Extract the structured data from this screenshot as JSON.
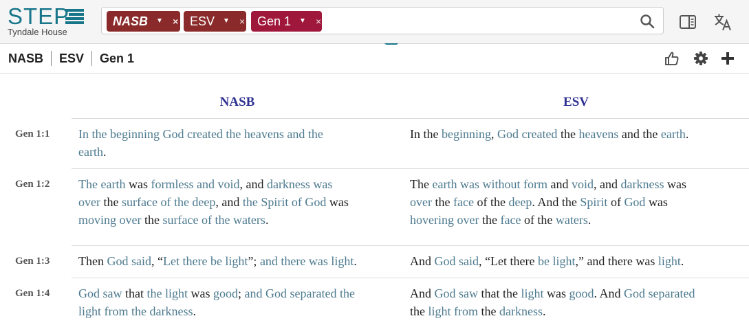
{
  "header": {
    "logo_text": "STEP",
    "logo_subtitle": "Tyndale House",
    "search_tags": [
      {
        "label": "NASB"
      },
      {
        "label": "ESV"
      },
      {
        "label": "Gen 1"
      }
    ],
    "remove_symbol": "×",
    "caret_symbol": "▼"
  },
  "subbar": {
    "crumbs": [
      "NASB",
      "ESV",
      "Gen 1"
    ]
  },
  "columns": {
    "left": "NASB",
    "right": "ESV"
  },
  "colors": {
    "brand": "#18768a",
    "tag_version": "#8b2a2a",
    "tag_reference": "#a0173c",
    "column_heading": "#2e3192",
    "linked_word": "#4d7a8f"
  },
  "verses": [
    {
      "ref": "Gen 1:1",
      "nasb": [
        [
          {
            "t": "In the beginning God created the heavens and the",
            "l": true
          }
        ],
        [
          {
            "t": "earth",
            "l": true
          },
          {
            "t": ".",
            "l": false
          }
        ]
      ],
      "esv": [
        [
          {
            "t": "In the ",
            "l": false
          },
          {
            "t": "beginning",
            "l": true
          },
          {
            "t": ", ",
            "l": false
          },
          {
            "t": "God created",
            "l": true
          },
          {
            "t": " the ",
            "l": false
          },
          {
            "t": "heavens",
            "l": true
          },
          {
            "t": " and the ",
            "l": false
          },
          {
            "t": "earth",
            "l": true
          },
          {
            "t": ".",
            "l": false
          }
        ]
      ]
    },
    {
      "ref": "Gen 1:2",
      "nasb": [
        [
          {
            "t": "The earth",
            "l": true
          },
          {
            "t": " was ",
            "l": false
          },
          {
            "t": "formless and void",
            "l": true
          },
          {
            "t": ", and ",
            "l": false
          },
          {
            "t": "darkness was",
            "l": true
          }
        ],
        [
          {
            "t": "over",
            "l": true
          },
          {
            "t": " the ",
            "l": false
          },
          {
            "t": "surface of the deep",
            "l": true
          },
          {
            "t": ", and ",
            "l": false
          },
          {
            "t": "the Spirit of God",
            "l": true
          },
          {
            "t": " was",
            "l": false
          }
        ],
        [
          {
            "t": "moving over",
            "l": true
          },
          {
            "t": " the ",
            "l": false
          },
          {
            "t": "surface of the waters",
            "l": true
          },
          {
            "t": ".",
            "l": false
          }
        ]
      ],
      "esv": [
        [
          {
            "t": "The ",
            "l": false
          },
          {
            "t": "earth was without form",
            "l": true
          },
          {
            "t": " and ",
            "l": false
          },
          {
            "t": "void",
            "l": true
          },
          {
            "t": ", and ",
            "l": false
          },
          {
            "t": "darkness",
            "l": true
          },
          {
            "t": " was",
            "l": false
          }
        ],
        [
          {
            "t": "over",
            "l": true
          },
          {
            "t": " the ",
            "l": false
          },
          {
            "t": "face",
            "l": true
          },
          {
            "t": " of the ",
            "l": false
          },
          {
            "t": "deep",
            "l": true
          },
          {
            "t": ". And the ",
            "l": false
          },
          {
            "t": "Spirit",
            "l": true
          },
          {
            "t": " of ",
            "l": false
          },
          {
            "t": "God",
            "l": true
          },
          {
            "t": " was",
            "l": false
          }
        ],
        [
          {
            "t": "hovering over",
            "l": true
          },
          {
            "t": " the ",
            "l": false
          },
          {
            "t": "face",
            "l": true
          },
          {
            "t": " of the ",
            "l": false
          },
          {
            "t": "waters",
            "l": true
          },
          {
            "t": ".",
            "l": false
          }
        ]
      ]
    },
    {
      "ref": "Gen 1:3",
      "nasb": [
        [
          {
            "t": "Then ",
            "l": false
          },
          {
            "t": "God said",
            "l": true
          },
          {
            "t": ", “",
            "l": false
          },
          {
            "t": "Let there be light",
            "l": true
          },
          {
            "t": "”; ",
            "l": false
          },
          {
            "t": "and there was light",
            "l": true
          },
          {
            "t": ".",
            "l": false
          }
        ]
      ],
      "esv": [
        [
          {
            "t": "And ",
            "l": false
          },
          {
            "t": "God said",
            "l": true
          },
          {
            "t": ", “Let there ",
            "l": false
          },
          {
            "t": "be light",
            "l": true
          },
          {
            "t": ",” and there was ",
            "l": false
          },
          {
            "t": "light",
            "l": true
          },
          {
            "t": ".",
            "l": false
          }
        ]
      ]
    },
    {
      "ref": "Gen 1:4",
      "nasb": [
        [
          {
            "t": "God saw",
            "l": true
          },
          {
            "t": " that ",
            "l": false
          },
          {
            "t": "the light",
            "l": true
          },
          {
            "t": " was ",
            "l": false
          },
          {
            "t": "good",
            "l": true
          },
          {
            "t": "; ",
            "l": false
          },
          {
            "t": "and God separated the",
            "l": true
          }
        ],
        [
          {
            "t": "light from the darkness",
            "l": true
          },
          {
            "t": ".",
            "l": false
          }
        ]
      ],
      "esv": [
        [
          {
            "t": "And ",
            "l": false
          },
          {
            "t": "God saw",
            "l": true
          },
          {
            "t": " that the ",
            "l": false
          },
          {
            "t": "light",
            "l": true
          },
          {
            "t": " was ",
            "l": false
          },
          {
            "t": "good",
            "l": true
          },
          {
            "t": ". And ",
            "l": false
          },
          {
            "t": "God separated",
            "l": true
          }
        ],
        [
          {
            "t": "the ",
            "l": false
          },
          {
            "t": "light from",
            "l": true
          },
          {
            "t": " the ",
            "l": false
          },
          {
            "t": "darkness",
            "l": true
          },
          {
            "t": ".",
            "l": false
          }
        ]
      ]
    }
  ]
}
